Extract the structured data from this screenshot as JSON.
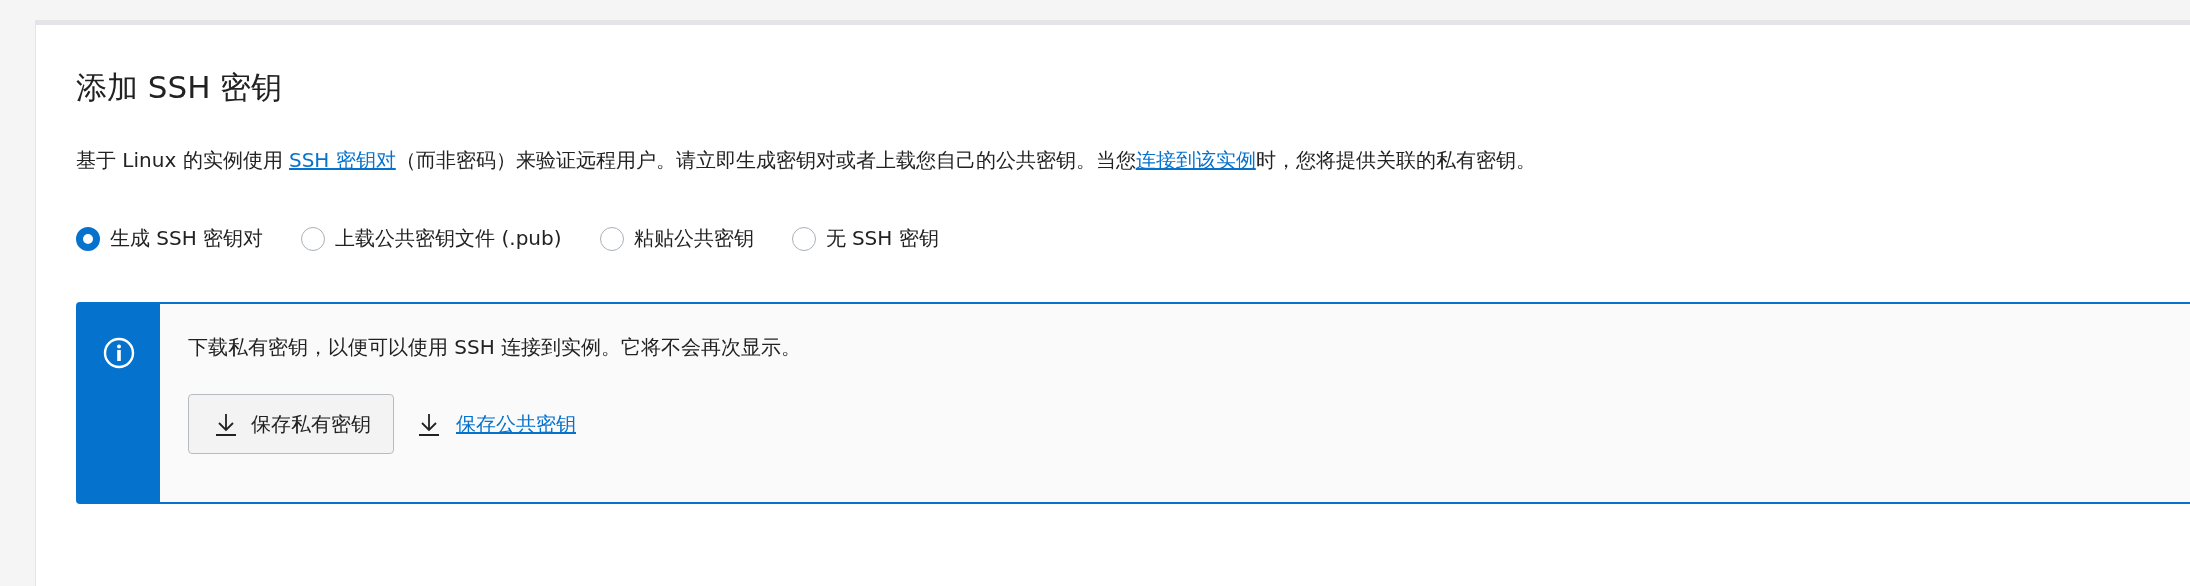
{
  "title": "添加 SSH 密钥",
  "description": [
    {
      "kind": "text",
      "text": "基于 Linux 的实例使用 "
    },
    {
      "kind": "link",
      "text": "SSH 密钥对"
    },
    {
      "kind": "text",
      "text": "（而非密码）来验证远程用户。请立即生成密钥对或者上载您自己的公共密钥。当您"
    },
    {
      "kind": "link",
      "text": "连接到该实例"
    },
    {
      "kind": "text",
      "text": "时，您将提供关联的私有密钥。"
    }
  ],
  "options": [
    {
      "label": "生成 SSH 密钥对",
      "selected": true
    },
    {
      "label": "上载公共密钥文件 (.pub)",
      "selected": false
    },
    {
      "label": "粘贴公共密钥",
      "selected": false
    },
    {
      "label": "无 SSH 密钥",
      "selected": false
    }
  ],
  "info": {
    "message": "下载私有密钥，以便可以使用 SSH 连接到实例。它将不会再次显示。",
    "actions": [
      {
        "kind": "button",
        "label": "保存私有密钥"
      },
      {
        "kind": "link",
        "label": "保存公共密钥"
      }
    ]
  }
}
